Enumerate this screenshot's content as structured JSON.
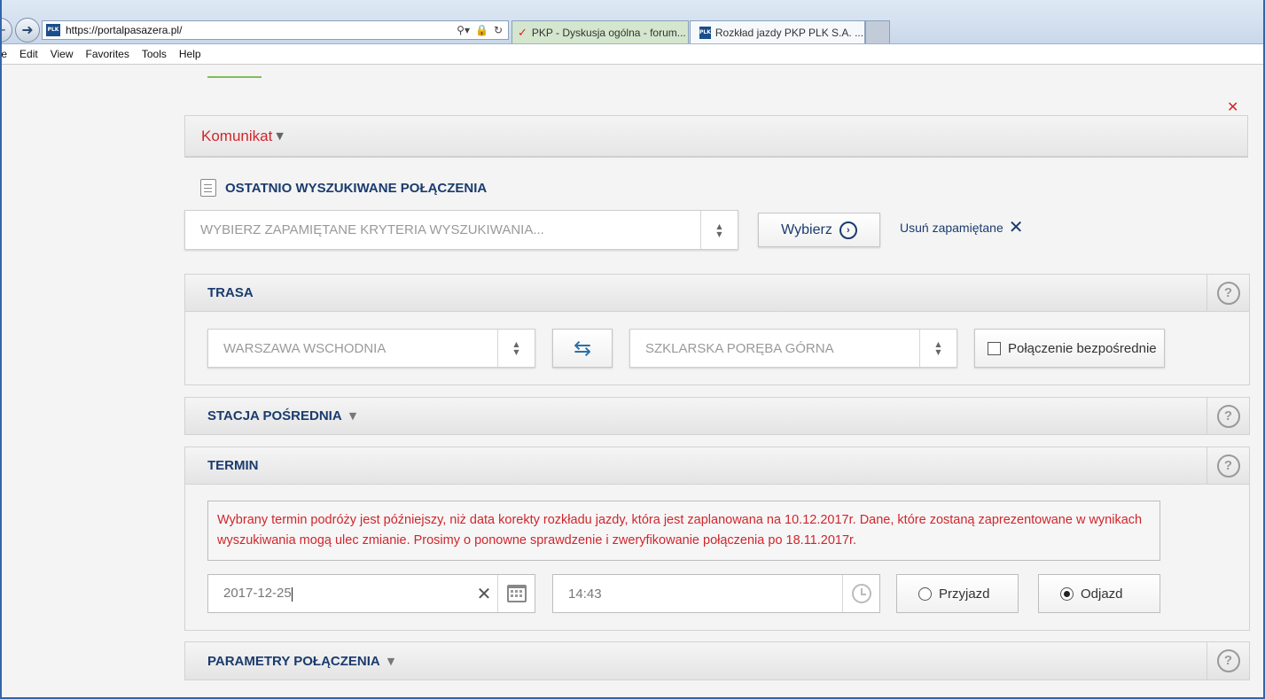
{
  "browser": {
    "url": "https://portalpasazera.pl/",
    "site_icon_text": "PLK",
    "tabs": [
      {
        "label": "PKP - Dyskusja ogólna - forum...",
        "active": false
      },
      {
        "label": "Rozkład jazdy PKP PLK S.A. ...",
        "active": true
      }
    ],
    "menu": [
      "ile",
      "Edit",
      "View",
      "Favorites",
      "Tools",
      "Help"
    ]
  },
  "page": {
    "komunikat": "Komunikat",
    "recent": {
      "title": "OSTATNIO WYSZUKIWANE POŁĄCZENIA",
      "placeholder": "WYBIERZ ZAPAMIĘTANE KRYTERIA WYSZUKIWANIA...",
      "choose_label": "Wybierz",
      "remove_label": "Usuń zapamiętane"
    },
    "trasa": {
      "title": "TRASA",
      "from_placeholder": "WARSZAWA WSCHODNIA",
      "to_placeholder": "SZKLARSKA PORĘBA GÓRNA",
      "direct_label": "Połączenie bezpośrednie"
    },
    "stacja": {
      "title": "STACJA POŚREDNIA"
    },
    "termin": {
      "title": "TERMIN",
      "warning": "Wybrany termin podróży jest późniejszy, niż data korekty rozkładu jazdy, która jest zaplanowana na 10.12.2017r. Dane, które zostaną zaprezentowane w wynikach wyszukiwania mogą ulec zmianie. Prosimy o ponowne sprawdzenie i zweryfikowanie połączenia po 18.11.2017r.",
      "date_value": "2017-12-25",
      "time_value": "14:43",
      "arrival_label": "Przyjazd",
      "departure_label": "Odjazd",
      "selected": "Odjazd"
    },
    "parametry": {
      "title": "PARAMETRY POŁĄCZENIA"
    }
  },
  "colors": {
    "accent_navy": "#1a3b6e",
    "alert_red": "#d0262c",
    "active_tab": "#d4e6cd"
  }
}
